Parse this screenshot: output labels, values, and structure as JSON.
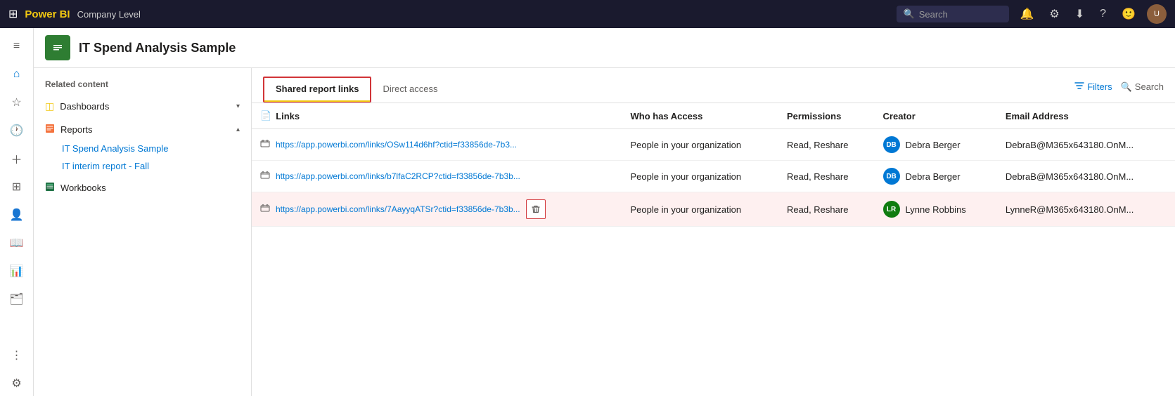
{
  "topnav": {
    "logo": "Power BI",
    "workspace": "Company Level",
    "search_placeholder": "Search"
  },
  "page_header": {
    "title": "IT Spend Analysis Sample",
    "icon": "📊"
  },
  "left_panel": {
    "section_title": "Related content",
    "sections": [
      {
        "label": "Dashboards",
        "icon": "dashboard",
        "expanded": false
      },
      {
        "label": "Reports",
        "icon": "report",
        "expanded": true,
        "items": [
          "IT Spend Analysis Sample",
          "IT interim report - Fall"
        ]
      },
      {
        "label": "Workbooks",
        "icon": "workbook"
      }
    ]
  },
  "tabs": [
    {
      "label": "Shared report links",
      "active": true
    },
    {
      "label": "Direct access",
      "active": false
    }
  ],
  "toolbar": {
    "filters_label": "Filters",
    "search_label": "Search"
  },
  "table": {
    "columns": [
      "Links",
      "Who has Access",
      "Permissions",
      "Creator",
      "Email Address"
    ],
    "rows": [
      {
        "link": "https://app.powerbi.com/links/OSw114d6hf?ctid=f33856de-7b3...",
        "who_has_access": "People in your organization",
        "permissions": "Read, Reshare",
        "creator": "Debra Berger",
        "email": "DebraB@M365x643180.OnM...",
        "delete": false,
        "highlighted": false
      },
      {
        "link": "https://app.powerbi.com/links/b7lfaC2RCP?ctid=f33856de-7b3b...",
        "who_has_access": "People in your organization",
        "permissions": "Read, Reshare",
        "creator": "Debra Berger",
        "email": "DebraB@M365x643180.OnM...",
        "delete": false,
        "highlighted": false
      },
      {
        "link": "https://app.powerbi.com/links/7AayyqATSr?ctid=f33856de-7b3b...",
        "who_has_access": "People in your organization",
        "permissions": "Read, Reshare",
        "creator": "Lynne Robbins",
        "email": "LynneR@M365x643180.OnM...",
        "delete": true,
        "highlighted": true
      }
    ]
  },
  "icons": {
    "grid": "⊞",
    "bell": "🔔",
    "settings": "⚙",
    "download": "⬇",
    "help": "?",
    "emoji": "🙂",
    "home": "⌂",
    "star": "☆",
    "recent": "🕐",
    "create": "+",
    "apps": "⊞",
    "shared": "👤",
    "learn": "📖",
    "metrics": "📊",
    "workspaces": "🗂",
    "browse": "⋮",
    "collapse": "≡",
    "filter": "▽",
    "search_small": "🔍",
    "link_icon": "🔗",
    "delete_icon": "🗑",
    "file_icon": "📄"
  }
}
